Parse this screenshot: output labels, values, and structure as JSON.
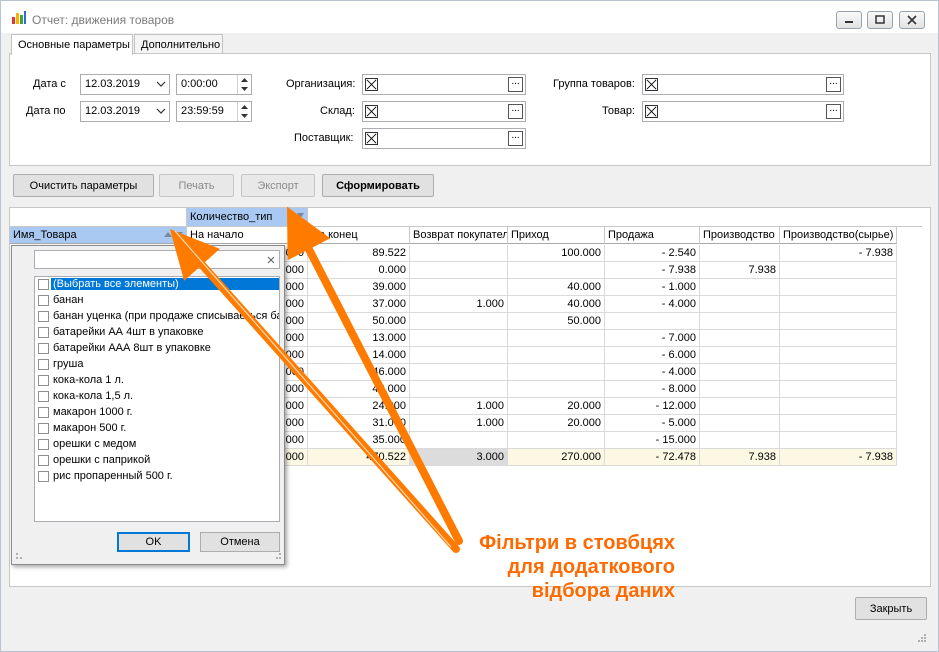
{
  "window": {
    "title": "Отчет: движения товаров"
  },
  "tabs": [
    {
      "label": "Основные параметры",
      "active": true
    },
    {
      "label": "Дополнительно",
      "active": false
    }
  ],
  "params": {
    "date_from_label": "Дата с",
    "date_from": "12.03.2019",
    "time_from": "0:00:00",
    "date_to_label": "Дата по",
    "date_to": "12.03.2019",
    "time_to": "23:59:59",
    "organization_label": "Организация:",
    "warehouse_label": "Склад:",
    "supplier_label": "Поставщик:",
    "product_group_label": "Группа товаров:",
    "product_label": "Товар:",
    "dots": "..."
  },
  "toolbar": {
    "clear": "Очистить параметры",
    "print": "Печать",
    "export": "Экспорт",
    "build": "Сформировать"
  },
  "grid": {
    "group_header": "Количество_тип",
    "columns": [
      "Имя_Товара",
      "На начало",
      "На конец",
      "Возврат покупателя",
      "Приход",
      "Продажа",
      "Производство",
      "Производство(сырье)"
    ],
    "rows": [
      {
        "start": "000",
        "end": "89.522",
        "ret": "",
        "inc": "100.000",
        "sale": "- 2.540",
        "prod": "",
        "raw": "- 7.938"
      },
      {
        "start": "000",
        "end": "0.000",
        "ret": "",
        "inc": "",
        "sale": "- 7.938",
        "prod": "7.938",
        "raw": ""
      },
      {
        "start": "000",
        "end": "39.000",
        "ret": "",
        "inc": "40.000",
        "sale": "- 1.000",
        "prod": "",
        "raw": ""
      },
      {
        "start": "000",
        "end": "37.000",
        "ret": "1.000",
        "inc": "40.000",
        "sale": "- 4.000",
        "prod": "",
        "raw": ""
      },
      {
        "start": "000",
        "end": "50.000",
        "ret": "",
        "inc": "50.000",
        "sale": "",
        "prod": "",
        "raw": ""
      },
      {
        "start": "000",
        "end": "13.000",
        "ret": "",
        "inc": "",
        "sale": "- 7.000",
        "prod": "",
        "raw": ""
      },
      {
        "start": "000",
        "end": "14.000",
        "ret": "",
        "inc": "",
        "sale": "- 6.000",
        "prod": "",
        "raw": ""
      },
      {
        "start": "000",
        "end": "46.000",
        "ret": "",
        "inc": "",
        "sale": "- 4.000",
        "prod": "",
        "raw": ""
      },
      {
        "start": "000",
        "end": "42.000",
        "ret": "",
        "inc": "",
        "sale": "- 8.000",
        "prod": "",
        "raw": ""
      },
      {
        "start": "000",
        "end": "24.000",
        "ret": "1.000",
        "inc": "20.000",
        "sale": "- 12.000",
        "prod": "",
        "raw": ""
      },
      {
        "start": "000",
        "end": "31.000",
        "ret": "1.000",
        "inc": "20.000",
        "sale": "- 5.000",
        "prod": "",
        "raw": ""
      },
      {
        "start": "000",
        "end": "35.000",
        "ret": "",
        "inc": "",
        "sale": "- 15.000",
        "prod": "",
        "raw": ""
      }
    ],
    "totals": {
      "start": "000",
      "end": "470.522",
      "ret": "3.000",
      "inc": "270.000",
      "sale": "- 72.478",
      "prod": "7.938",
      "raw": "- 7.938"
    }
  },
  "filter_popup": {
    "search_value": "",
    "items": [
      "(Выбрать все элементы)",
      "банан",
      "банан уценка (при продаже списываеться ба",
      "батарейки АА 4шт в упаковке",
      "батарейки ААА 8шт в упаковке",
      "груша",
      "кока-кола 1 л.",
      "кока-кола 1,5 л.",
      "макарон 1000 г.",
      "макарон 500 г.",
      "орешки с медом",
      "орешки с паприкой",
      "рис пропаренный 500 г."
    ],
    "ok": "OK",
    "cancel": "Отмена"
  },
  "close_button": "Закрыть",
  "annotation": {
    "lines": [
      "Фільтри в стовбцях",
      "для додаткового",
      "відбора даних"
    ],
    "color": "#ff6a00"
  }
}
